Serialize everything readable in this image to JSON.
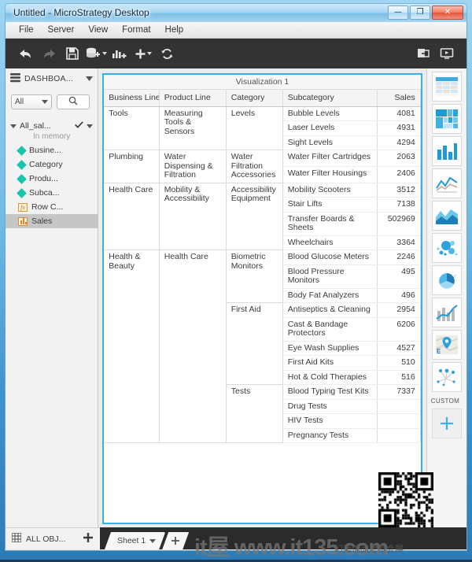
{
  "window": {
    "title": "Untitled - MicroStrategy Desktop",
    "minimize": "—",
    "maximize": "❐",
    "close": "✕"
  },
  "menubar": {
    "items": [
      "File",
      "Server",
      "View",
      "Format",
      "Help"
    ]
  },
  "toolbar": {
    "items": [
      {
        "name": "undo-button",
        "icon": "undo-arrow-icon",
        "enabled": true
      },
      {
        "name": "redo-button",
        "icon": "redo-arrow-icon",
        "enabled": false
      },
      {
        "name": "save-button",
        "icon": "floppy-disk-icon",
        "enabled": true
      },
      {
        "name": "add-data-button",
        "icon": "database-plus-icon",
        "enabled": true,
        "caret": true
      },
      {
        "name": "add-visualization-button",
        "icon": "bar-chart-plus-icon",
        "enabled": true
      },
      {
        "name": "insert-button",
        "icon": "plus-icon",
        "enabled": true,
        "caret": true
      },
      {
        "name": "refresh-button",
        "icon": "refresh-icon",
        "enabled": true
      }
    ],
    "right_items": [
      {
        "name": "share-button",
        "icon": "share-page-icon"
      },
      {
        "name": "presentation-button",
        "icon": "monitor-play-icon"
      }
    ]
  },
  "left_panel": {
    "header_label": "DASHBOA...",
    "header_icon": "dataset-stack-icon",
    "filter_value": "All",
    "search_icon": "search-icon",
    "dataset": {
      "name": "All_sal...",
      "status": "In memory",
      "check_icon": "checkmark-icon"
    },
    "items": [
      {
        "label": "Busine...",
        "icon": "attribute-diamond-icon",
        "selected": false
      },
      {
        "label": "Category",
        "icon": "attribute-diamond-icon",
        "selected": false
      },
      {
        "label": "Produ...",
        "icon": "attribute-diamond-icon",
        "selected": false
      },
      {
        "label": "Subca...",
        "icon": "attribute-diamond-icon",
        "selected": false
      },
      {
        "label": "Row C...",
        "icon": "fx-metric-icon",
        "selected": false
      },
      {
        "label": "Sales",
        "icon": "metric-bars-icon",
        "selected": true
      }
    ],
    "footer_label": "ALL OBJ...",
    "footer_icon": "all-objects-grid-icon",
    "footer_add_icon": "plus-icon"
  },
  "visualization": {
    "title": "Visualization 1",
    "columns": [
      "Business Line",
      "Product Line",
      "Category",
      "Subcategory",
      "Sales"
    ],
    "rows": [
      {
        "business_line": "Tools",
        "product_line": "Measuring Tools & Sensors",
        "category": "Levels",
        "subcategory": "Bubble Levels",
        "sales": "4081",
        "group_start": true,
        "bl_span": 3,
        "pl_span": 3,
        "cat_span": 3
      },
      {
        "subcategory": "Laser Levels",
        "sales": "4931"
      },
      {
        "subcategory": "Sight Levels",
        "sales": "4294"
      },
      {
        "business_line": "Plumbing",
        "product_line": "Water Dispensing & Filtration",
        "category": "Water Filtration Accessories",
        "subcategory": "Water Filter Cartridges",
        "sales": "2063",
        "group_start": true,
        "bl_span": 2,
        "pl_span": 2,
        "cat_span": 2
      },
      {
        "subcategory": "Water Filter Housings",
        "sales": "2406"
      },
      {
        "business_line": "Health Care",
        "product_line": "Mobility & Accessibility",
        "category": "Accessibility Equipment",
        "subcategory": "Mobility Scooters",
        "sales": "3512",
        "group_start": true,
        "bl_span": 4,
        "pl_span": 4,
        "cat_span": 4
      },
      {
        "subcategory": "Stair Lifts",
        "sales": "7138"
      },
      {
        "subcategory": "Transfer Boards & Sheets",
        "sales": "502969"
      },
      {
        "subcategory": "Wheelchairs",
        "sales": "3364"
      },
      {
        "business_line": "Health & Beauty",
        "product_line": "Health Care",
        "category": "Biometric Monitors",
        "subcategory": "Blood Glucose Meters",
        "sales": "2246",
        "group_start": true,
        "bl_span": 12,
        "pl_span": 12,
        "cat_span": 3
      },
      {
        "subcategory": "Blood Pressure Monitors",
        "sales": "495"
      },
      {
        "subcategory": "Body Fat Analyzers",
        "sales": "496"
      },
      {
        "category": "First Aid",
        "subcategory": "Antiseptics & Cleaning",
        "sales": "2954",
        "cat_span": 5
      },
      {
        "subcategory": "Cast & Bandage Protectors",
        "sales": "6206"
      },
      {
        "subcategory": "Eye Wash Supplies",
        "sales": "4527"
      },
      {
        "subcategory": "First Aid Kits",
        "sales": "510"
      },
      {
        "subcategory": "Hot & Cold Therapies",
        "sales": "516"
      },
      {
        "category": "Tests",
        "subcategory": "Blood Typing Test Kits",
        "sales": "7337",
        "cat_span": 4
      },
      {
        "subcategory": "Drug Tests",
        "sales": ""
      },
      {
        "subcategory": "HIV Tests",
        "sales": ""
      },
      {
        "subcategory": "Pregnancy Tests",
        "sales": ""
      }
    ]
  },
  "right_panel": {
    "gallery": [
      {
        "name": "grid-visualization",
        "icon": "grid-table-icon"
      },
      {
        "name": "heatmap-visualization",
        "icon": "heat-map-icon"
      },
      {
        "name": "bar-chart-visualization",
        "icon": "bar-chart-icon"
      },
      {
        "name": "line-chart-visualization",
        "icon": "line-chart-icon"
      },
      {
        "name": "area-chart-visualization",
        "icon": "area-chart-icon"
      },
      {
        "name": "bubble-chart-visualization",
        "icon": "bubble-chart-icon"
      },
      {
        "name": "pie-chart-visualization",
        "icon": "pie-chart-icon"
      },
      {
        "name": "combo-chart-visualization",
        "icon": "combo-chart-icon"
      },
      {
        "name": "map-visualization",
        "icon": "map-pin-icon"
      },
      {
        "name": "network-visualization",
        "icon": "network-graph-icon"
      }
    ],
    "custom_label": "CUSTOM",
    "add_custom_icon": "plus-icon"
  },
  "bottom": {
    "sheet_tab": "Sheet 1",
    "sheet_caret_icon": "chevron-down-icon",
    "add_sheet_icon": "plus-icon"
  },
  "watermark": {
    "main": "it屋 www.it135.com",
    "sub": "幻海优品虚拟会展"
  },
  "colors": {
    "accent": "#37b0e8",
    "teal": "#18c5ae",
    "toolbar_bg": "#333333",
    "selection": "#c6c6c6"
  }
}
